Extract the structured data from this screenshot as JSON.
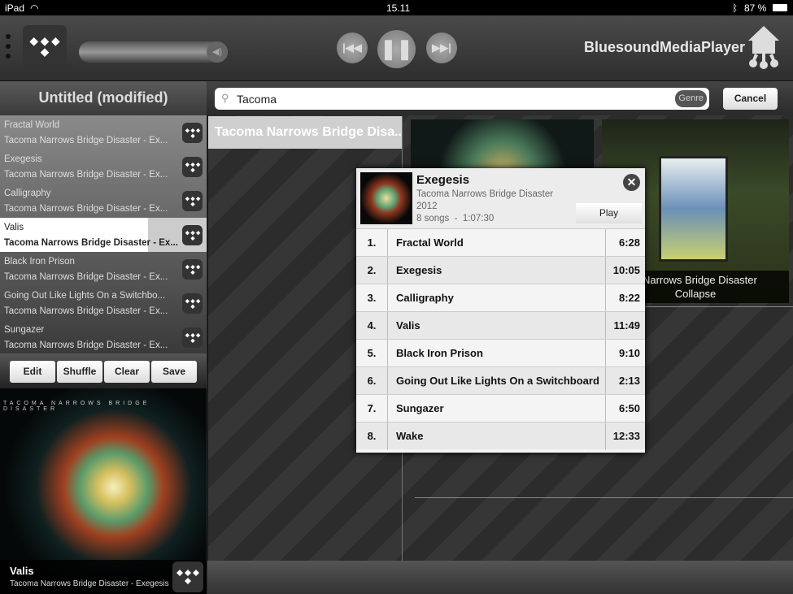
{
  "status": {
    "device": "iPad",
    "time": "15.11",
    "battery": "87 %"
  },
  "header": {
    "brand": "BluesoundMediaPlayer"
  },
  "playlist": {
    "title": "Untitled (modified)",
    "items": [
      {
        "title": "Fractal World",
        "subtitle": "Tacoma Narrows Bridge Disaster - Ex..."
      },
      {
        "title": "Exegesis",
        "subtitle": "Tacoma Narrows Bridge Disaster - Ex..."
      },
      {
        "title": "Calligraphy",
        "subtitle": "Tacoma Narrows Bridge Disaster - Ex..."
      },
      {
        "title": "Valis",
        "subtitle": "Tacoma Narrows Bridge Disaster - Ex..."
      },
      {
        "title": "Black Iron Prison",
        "subtitle": "Tacoma Narrows Bridge Disaster - Ex..."
      },
      {
        "title": "Going Out Like Lights On a Switchbo...",
        "subtitle": "Tacoma Narrows Bridge Disaster - Ex..."
      },
      {
        "title": "Sungazer",
        "subtitle": "Tacoma Narrows Bridge Disaster - Ex..."
      }
    ],
    "buttons": {
      "edit": "Edit",
      "shuffle": "Shuffle",
      "clear": "Clear",
      "save": "Save"
    }
  },
  "now_playing": {
    "band": "TACOMA NARROWS BRIDGE DISASTER",
    "title": "Valis",
    "subtitle": "Tacoma Narrows Bridge Disaster - Exegesis"
  },
  "search": {
    "value": "Tacoma",
    "genre": "Genre",
    "cancel": "Cancel"
  },
  "results": {
    "artist": "Tacoma Narrows Bridge Disa...",
    "album2_artist": "a Narrows Bridge Disaster",
    "album2_title": "Collapse"
  },
  "popup": {
    "album": "Exegesis",
    "artist": "Tacoma Narrows Bridge Disaster",
    "year": "2012",
    "info": "8 songs  -  1:07:30",
    "play": "Play",
    "tracks": [
      {
        "n": "1.",
        "title": "Fractal World",
        "dur": "6:28"
      },
      {
        "n": "2.",
        "title": "Exegesis",
        "dur": "10:05"
      },
      {
        "n": "3.",
        "title": "Calligraphy",
        "dur": "8:22"
      },
      {
        "n": "4.",
        "title": "Valis",
        "dur": "11:49"
      },
      {
        "n": "5.",
        "title": "Black Iron Prison",
        "dur": "9:10"
      },
      {
        "n": "6.",
        "title": "Going Out Like Lights On a Switchboard",
        "dur": "2:13"
      },
      {
        "n": "7.",
        "title": "Sungazer",
        "dur": "6:50"
      },
      {
        "n": "8.",
        "title": "Wake",
        "dur": "12:33"
      }
    ]
  }
}
